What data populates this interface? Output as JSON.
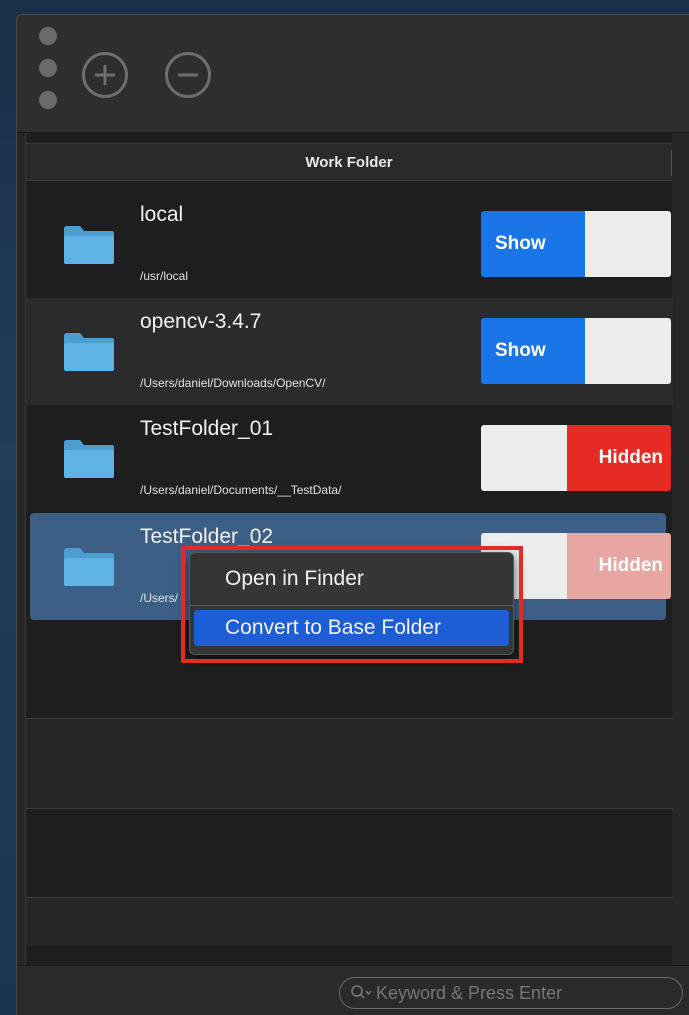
{
  "table": {
    "column_header": "Work Folder",
    "rows": [
      {
        "name": "local",
        "path": "/usr/local",
        "toggle": "Show"
      },
      {
        "name": "opencv-3.4.7",
        "path": "/Users/daniel/Downloads/OpenCV/",
        "toggle": "Show"
      },
      {
        "name": "TestFolder_01",
        "path": "/Users/daniel/Documents/__TestData/",
        "toggle": "Hidden"
      },
      {
        "name": "TestFolder_02",
        "path": "/Users/",
        "toggle": "Hidden"
      }
    ]
  },
  "context_menu": {
    "items": [
      {
        "label": "Open in Finder"
      },
      {
        "label": "Convert to Base Folder"
      }
    ]
  },
  "search": {
    "placeholder": "Keyword & Press Enter"
  },
  "colors": {
    "show": "#1a75e6",
    "hidden": "#e52b24",
    "selection": "#3d5f86",
    "menu_highlight": "#1d5ed6",
    "folder": "#5fb3e4"
  }
}
